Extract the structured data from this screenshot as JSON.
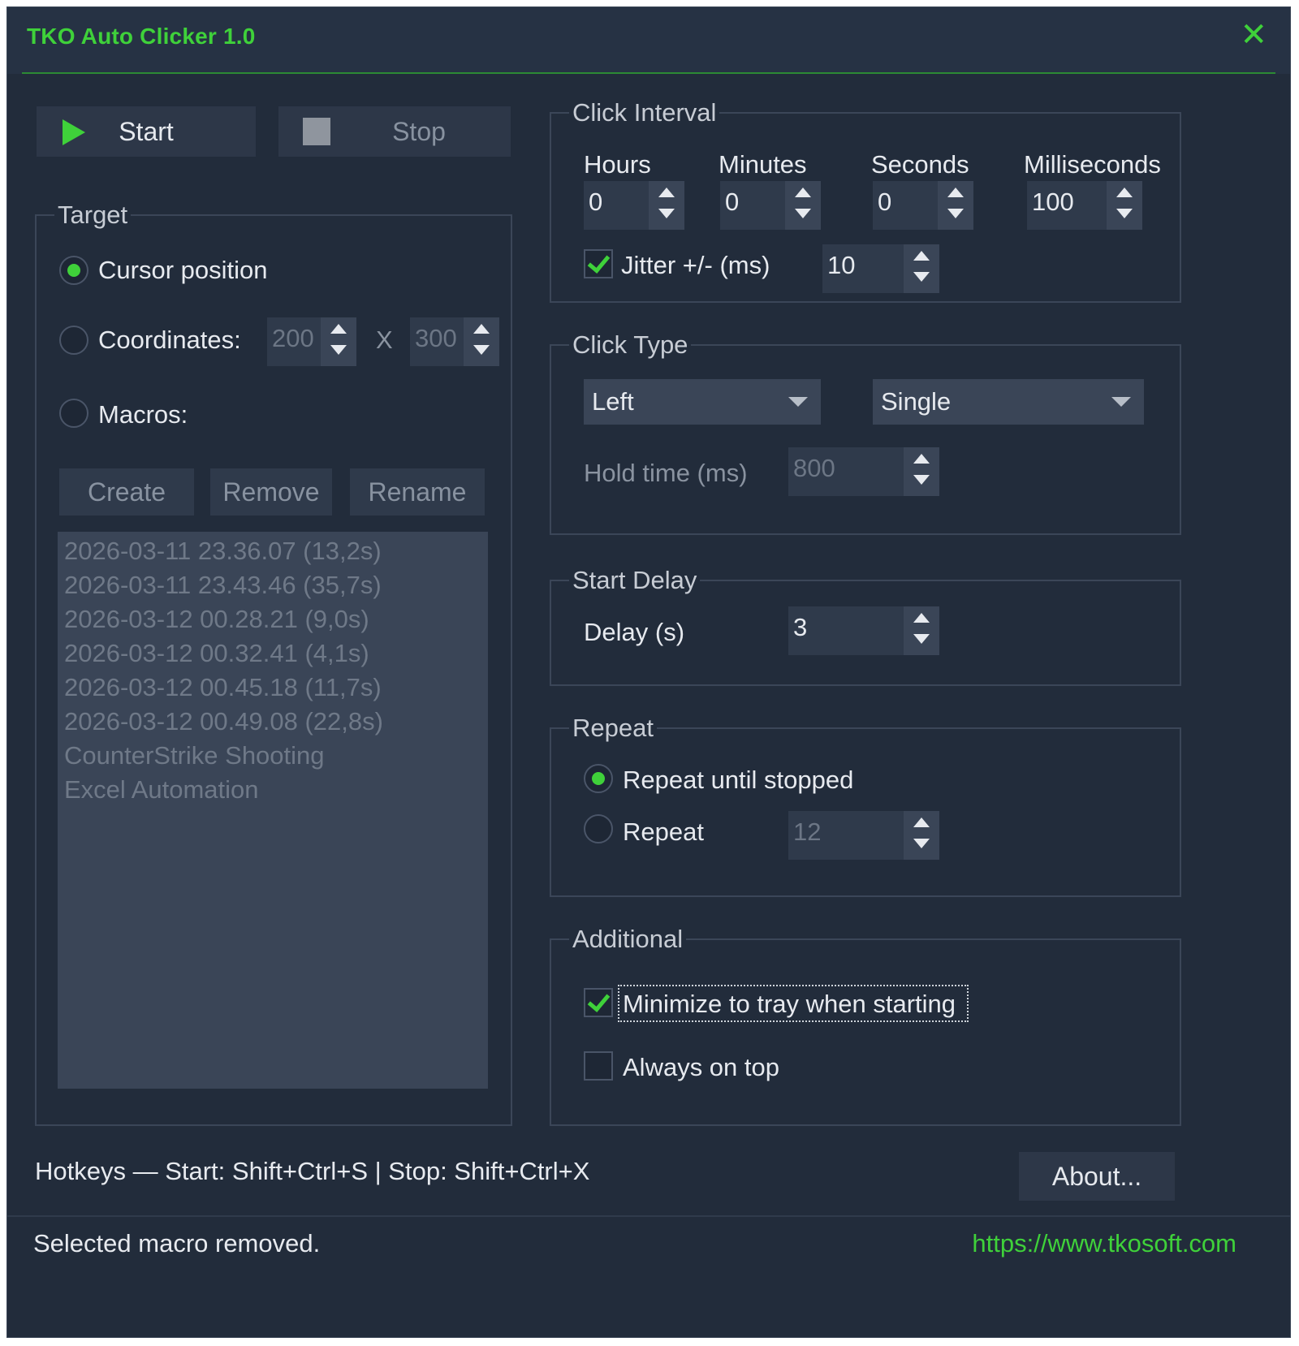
{
  "window": {
    "title": "TKO Auto Clicker 1.0"
  },
  "toolbar": {
    "start_label": "Start",
    "stop_label": "Stop"
  },
  "target": {
    "legend": "Target",
    "cursor_label": "Cursor position",
    "coords_label": "Coordinates:",
    "coord_x": "200",
    "coord_sep": "X",
    "coord_y": "300",
    "macros_label": "Macros:",
    "selected": "cursor",
    "buttons": {
      "create": "Create",
      "remove": "Remove",
      "rename": "Rename"
    },
    "macros": [
      "2026-03-11 23.36.07 (13,2s)",
      "2026-03-11 23.43.46 (35,7s)",
      "2026-03-12 00.28.21 (9,0s)",
      "2026-03-12 00.32.41 (4,1s)",
      "2026-03-12 00.45.18 (11,7s)",
      "2026-03-12 00.49.08 (22,8s)",
      "CounterStrike Shooting",
      "Excel Automation"
    ]
  },
  "interval": {
    "legend": "Click Interval",
    "hours_label": "Hours",
    "hours": "0",
    "minutes_label": "Minutes",
    "minutes": "0",
    "seconds_label": "Seconds",
    "seconds": "0",
    "ms_label": "Milliseconds",
    "ms": "100",
    "jitter_label": "Jitter +/- (ms)",
    "jitter": "10",
    "jitter_checked": true
  },
  "click_type": {
    "legend": "Click Type",
    "button": "Left",
    "mode": "Single",
    "hold_label": "Hold time (ms)",
    "hold": "800"
  },
  "start_delay": {
    "legend": "Start Delay",
    "delay_label": "Delay (s)",
    "delay": "3"
  },
  "repeat": {
    "legend": "Repeat",
    "until_label": "Repeat until stopped",
    "count_label": "Repeat",
    "count": "12",
    "selected": "until"
  },
  "additional": {
    "legend": "Additional",
    "minimize_label": "Minimize to tray when starting",
    "minimize_checked": true,
    "ontop_label": "Always on top",
    "ontop_checked": false
  },
  "footer": {
    "hotkeys": "Hotkeys — Start: Shift+Ctrl+S  |  Stop: Shift+Ctrl+X",
    "about": "About...",
    "status": "Selected macro removed.",
    "link": "https://www.tkosoft.com"
  },
  "colors": {
    "accent": "#3fd13a",
    "background": "#222c3b",
    "panel": "#2d3748"
  },
  "icons": {
    "start": "play-icon",
    "stop": "stop-icon",
    "close": "close-icon"
  }
}
